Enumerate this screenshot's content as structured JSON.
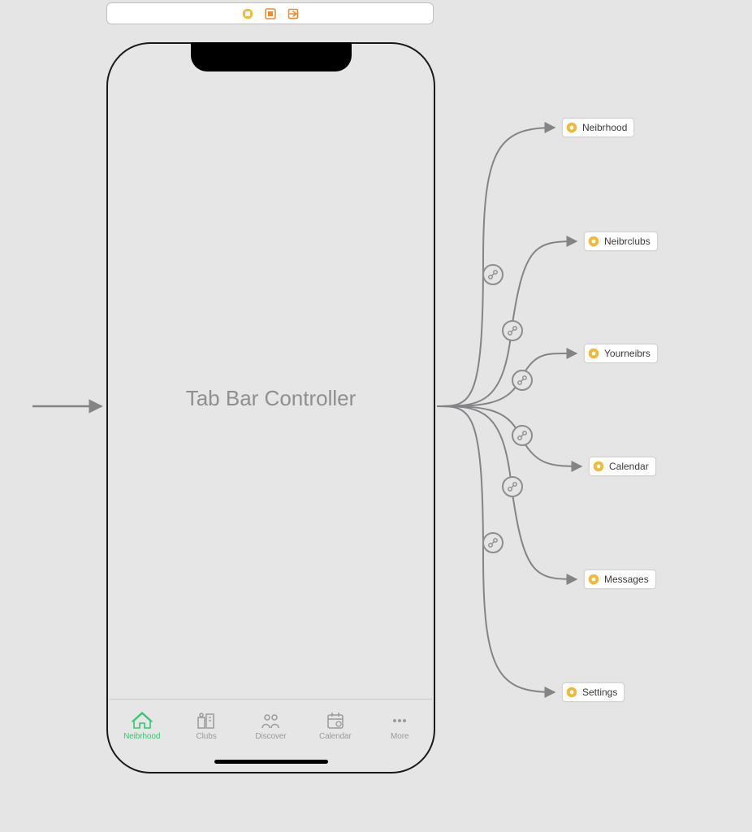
{
  "scene": {
    "title": "Tab Bar Controller"
  },
  "tabs": [
    {
      "label": "Neibrhood",
      "active": true
    },
    {
      "label": "Clubs",
      "active": false
    },
    {
      "label": "Discover",
      "active": false
    },
    {
      "label": "Calendar",
      "active": false
    },
    {
      "label": "More",
      "active": false
    }
  ],
  "destinations": [
    {
      "label": "Neibrhood"
    },
    {
      "label": "Neibrclubs"
    },
    {
      "label": "Yourneibrs"
    },
    {
      "label": "Calendar"
    },
    {
      "label": "Messages"
    },
    {
      "label": "Settings"
    }
  ],
  "colors": {
    "active_tint": "#30c96b",
    "inactive_tint": "#9a9a9e",
    "arrow": "#848487",
    "ref_icon": "#f0b93a"
  }
}
